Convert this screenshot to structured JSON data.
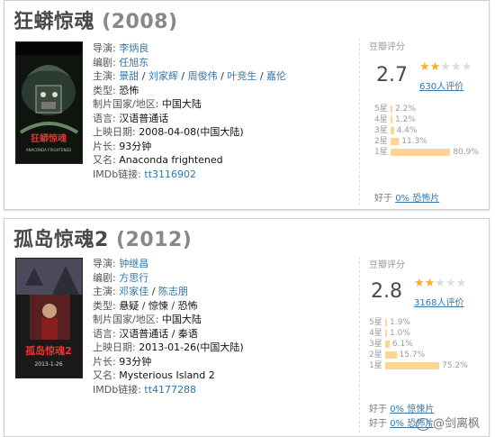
{
  "movies": [
    {
      "title": "狂蟒惊魂",
      "year": "(2008)",
      "director_label": "导演:",
      "director": "李炳良",
      "writer_label": "编剧:",
      "writer": "任旭东",
      "cast_label": "主演:",
      "cast": [
        "景甜",
        "刘家辉",
        "周俊伟",
        "叶竞生",
        "嘉伦"
      ],
      "genre_label": "类型:",
      "genre": "恐怖",
      "country_label": "制片国家/地区:",
      "country": "中国大陆",
      "language_label": "语言:",
      "language": "汉语普通话",
      "release_label": "上映日期:",
      "release": "2008-04-08(中国大陆)",
      "runtime_label": "片长:",
      "runtime": "93分钟",
      "aka_label": "又名:",
      "aka": "Anaconda frightened",
      "imdb_label": "IMDb链接:",
      "imdb": "tt3116902",
      "poster_text": "ANACONDA FRIGHTENED",
      "rating": {
        "heading": "豆瓣评分",
        "score": "2.7",
        "stars": 1.5,
        "votes": "630人评价",
        "distribution": [
          {
            "label": "5星",
            "pct": "2.2%",
            "value": 2.2
          },
          {
            "label": "4星",
            "pct": "1.2%",
            "value": 1.2
          },
          {
            "label": "3星",
            "pct": "4.4%",
            "value": 4.4
          },
          {
            "label": "2星",
            "pct": "11.3%",
            "value": 11.3
          },
          {
            "label": "1星",
            "pct": "80.9%",
            "value": 80.9
          }
        ],
        "better_prefix": "好于",
        "better_1": "0% 恐怖片"
      }
    },
    {
      "title": "孤岛惊魂2",
      "year": "(2012)",
      "director_label": "导演:",
      "director": "钟继昌",
      "writer_label": "编剧:",
      "writer": "方思行",
      "cast_label": "主演:",
      "cast": [
        "邓家佳",
        "陈志朋"
      ],
      "genre_label": "类型:",
      "genre": [
        "悬疑",
        "惊悚",
        "恐怖"
      ],
      "country_label": "制片国家/地区:",
      "country": "中国大陆",
      "language_label": "语言:",
      "language": "汉语普通话 / 秦语",
      "release_label": "上映日期:",
      "release": "2013-01-26(中国大陆)",
      "runtime_label": "片长:",
      "runtime": "93分钟",
      "aka_label": "又名:",
      "aka": "Mysterious Island 2",
      "imdb_label": "IMDb链接:",
      "imdb": "tt4177288",
      "poster_text": "孤岛惊魂2",
      "poster_date": "2013-1-26",
      "rating": {
        "heading": "豆瓣评分",
        "score": "2.8",
        "stars": 1.5,
        "votes": "3168人评价",
        "distribution": [
          {
            "label": "5星",
            "pct": "1.9%",
            "value": 1.9
          },
          {
            "label": "4星",
            "pct": "1.0%",
            "value": 1.0
          },
          {
            "label": "3星",
            "pct": "6.1%",
            "value": 6.1
          },
          {
            "label": "2星",
            "pct": "15.7%",
            "value": 15.7
          },
          {
            "label": "1星",
            "pct": "75.2%",
            "value": 75.2
          }
        ],
        "better_prefix": "好于",
        "better_1": "0% 惊悚片",
        "better_2": "0% 恐怖片"
      }
    }
  ],
  "watermark": "@剑离枫"
}
